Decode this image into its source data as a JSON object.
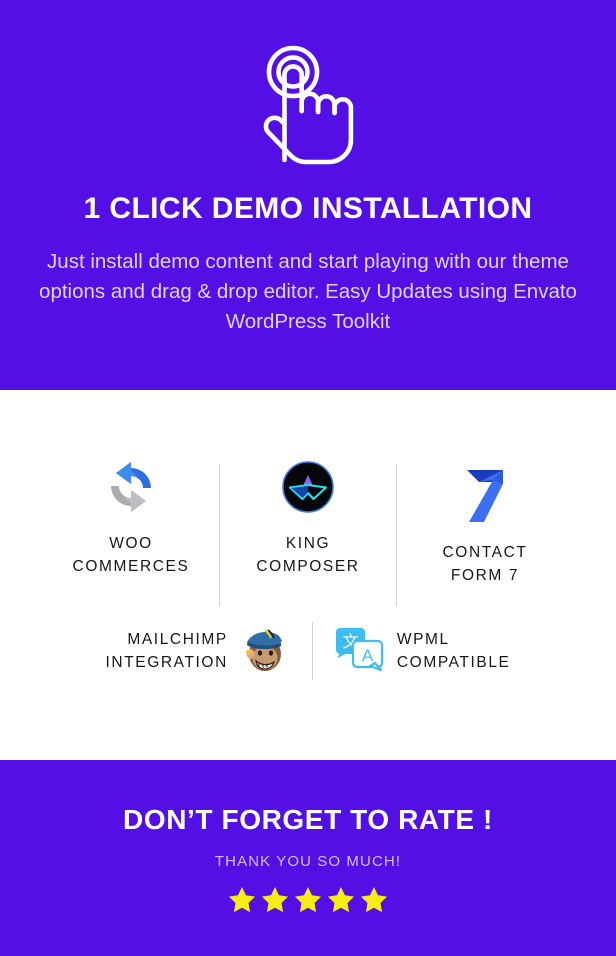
{
  "hero": {
    "icon": "tap-hand-icon",
    "title": "1 CLICK DEMO INSTALLATION",
    "description": "Just install demo content and start playing with our theme options and drag & drop editor. Easy Updates using Envato WordPress Toolkit",
    "bg_color": "#5410e4",
    "title_color": "#ffffff",
    "text_color": "#ded3fb"
  },
  "plugins": {
    "bg_color": "#ffffff",
    "label_color": "#17171b",
    "divider_color": "#cfcfd4",
    "row1": [
      {
        "icon": "woocommerce-refresh-icon",
        "label_line1": "WOO",
        "label_line2": "COMMERCES"
      },
      {
        "icon": "king-composer-icon",
        "label_line1": "KING",
        "label_line2": "COMPOSER"
      },
      {
        "icon": "contact-form-7-icon",
        "label_line1": "CONTACT",
        "label_line2": "FORM 7"
      }
    ],
    "row2": [
      {
        "icon": "mailchimp-monkey-icon",
        "label_line1": "MAILCHIMP",
        "label_line2": "INTEGRATION"
      },
      {
        "icon": "wpml-translate-icon",
        "label_line1": "WPML",
        "label_line2": "COMPATIBLE"
      }
    ]
  },
  "rate": {
    "bg_color": "#5410e4",
    "title": "DON’T FORGET TO RATE !",
    "subtitle": "THANK YOU SO MUCH!",
    "subtitle_color": "#cfc0f5",
    "star_count": 5,
    "star_color": "#f7ec13"
  }
}
